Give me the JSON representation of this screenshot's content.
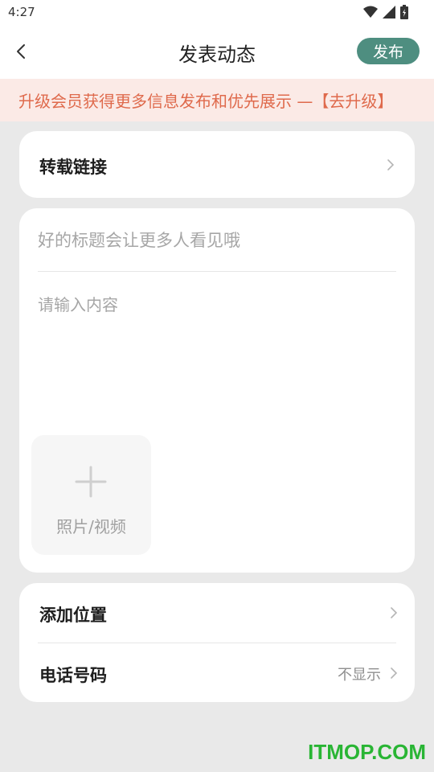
{
  "status_bar": {
    "time": "4:27",
    "icons": [
      "wifi-icon",
      "signal-icon",
      "battery-icon"
    ]
  },
  "app_bar": {
    "title": "发表动态",
    "publish_label": "发布",
    "back_icon": "back-arrow-icon"
  },
  "banner": {
    "text": "升级会员获得更多信息发布和优先展示 —【去升级】"
  },
  "repost": {
    "label": "转载链接"
  },
  "editor": {
    "title_placeholder": "好的标题会让更多人看见哦",
    "content_placeholder": "请输入内容",
    "media_label": "照片/视频"
  },
  "settings": {
    "location_label": "添加位置",
    "phone_label": "电话号码",
    "phone_value": "不显示"
  },
  "watermark": {
    "text": "ITMOP.COM"
  },
  "colors": {
    "accent": "#4e8e80",
    "banner_bg": "#fbeae6",
    "banner_text": "#df6a4c",
    "page_bg": "#e9e9e9",
    "watermark": "#29b534"
  }
}
